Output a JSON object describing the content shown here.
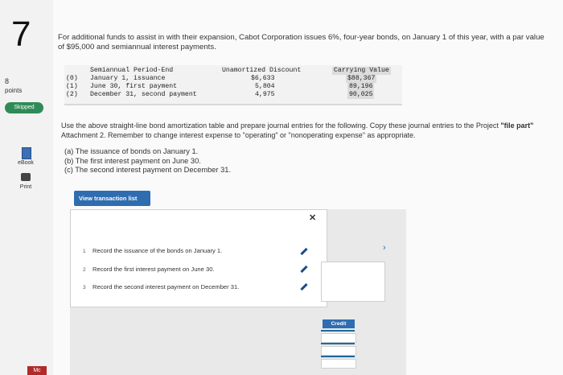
{
  "question": {
    "number": "7",
    "points": "8",
    "points_label": "points",
    "status": "Skipped"
  },
  "sidebar": {
    "ebook": "eBook",
    "print": "Print",
    "brand": "Mc"
  },
  "intro": "For additional funds to assist in with their expansion, Cabot Corporation issues 6%, four-year bonds, on January 1 of this year, with a par value of $95,000 and semiannual interest payments.",
  "table": {
    "headers": {
      "period": "Semiannual Period-End",
      "discount": "Unamortized Discount",
      "carrying": "Carrying Value"
    },
    "rows": [
      {
        "idx": "(0)",
        "period": "January 1, issuance",
        "discount": "$6,633",
        "carrying": "$88,367"
      },
      {
        "idx": "(1)",
        "period": "June 30, first payment",
        "discount": "5,804",
        "carrying": "89,196"
      },
      {
        "idx": "(2)",
        "period": "December 31, second payment",
        "discount": "4,975",
        "carrying": "90,025"
      }
    ]
  },
  "instructions": {
    "line1": "Use the above straight-line bond amortization table and prepare journal entries for the following. Copy these journal entries to the",
    "line2_pre": "Project ",
    "line2_bold": "\"file part\"",
    "line2_post": " Attachment 2. Remember to change interest expense to \"operating\" or \"nonoperating expense\" as appropriate."
  },
  "parts": [
    "(a) The issuance of bonds on January 1.",
    "(b) The first interest payment on June 30.",
    "(c) The second interest payment on December 31."
  ],
  "view_button": "View transaction list",
  "transactions": [
    {
      "n": "1",
      "text": "Record the issuance of the bonds on January 1."
    },
    {
      "n": "2",
      "text": "Record the first interest payment on June 30."
    },
    {
      "n": "3",
      "text": "Record the second interest payment on December 31."
    }
  ],
  "close_symbol": "✕",
  "next_symbol": "›",
  "credit_label": "Credit",
  "colors": {
    "accent": "#2f6db0",
    "skipped": "#2e8b57",
    "brand": "#b12a2a"
  }
}
